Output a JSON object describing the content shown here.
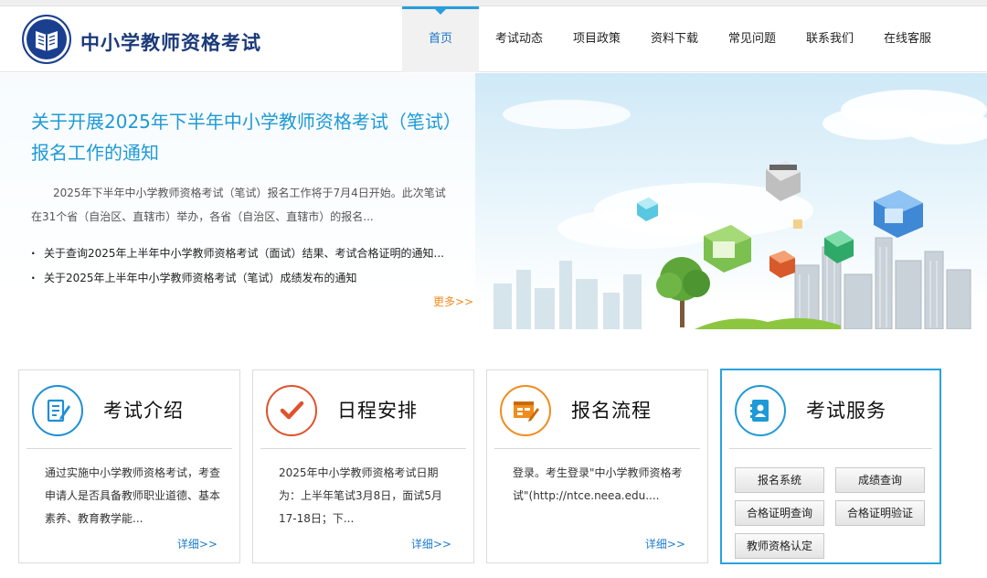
{
  "header": {
    "site_title": "中小学教师资格考试",
    "nav": [
      {
        "label": "首页",
        "active": true
      },
      {
        "label": "考试动态"
      },
      {
        "label": "项目政策"
      },
      {
        "label": "资料下载"
      },
      {
        "label": "常见问题"
      },
      {
        "label": "联系我们"
      },
      {
        "label": "在线客服"
      }
    ]
  },
  "banner": {
    "headline": "关于开展2025年下半年中小学教师资格考试（笔试）报名工作的通知",
    "summary": "2025年下半年中小学教师资格考试（笔试）报名工作将于7月4日开始。此次笔试在31个省（自治区、直辖市）举办，各省（自治区、直辖市）的报名...",
    "news": [
      "关于查询2025年上半年中小学教师资格考试（面试）结果、考试合格证明的通知...",
      "关于2025年上半年中小学教师资格考试（笔试）成绩发布的通知"
    ],
    "more": "更多>>"
  },
  "cards": [
    {
      "title": "考试介绍",
      "icon": "document-edit-icon",
      "accent": "#1e8fd6",
      "desc": "通过实施中小学教师资格考试，考查申请人是否具备教师职业道德、基本素养、教育教学能...",
      "more": "详细>>"
    },
    {
      "title": "日程安排",
      "icon": "checkmark-icon",
      "accent": "#e0522c",
      "desc": "2025年中小学教师资格考试日期为：上半年笔试3月8日，面试5月17-18日；下...",
      "more": "详细>>"
    },
    {
      "title": "报名流程",
      "icon": "form-pen-icon",
      "accent": "#f08c1e",
      "desc": "登录。考生登录\"中小学教师资格考试\"(http://ntce.neea.edu....",
      "more": "详细>>"
    },
    {
      "title": "考试服务",
      "icon": "address-book-icon",
      "accent": "#1e9ad6",
      "buttons": [
        "报名系统",
        "成绩查询",
        "合格证明查询",
        "合格证明验证",
        "教师资格认定"
      ]
    }
  ]
}
